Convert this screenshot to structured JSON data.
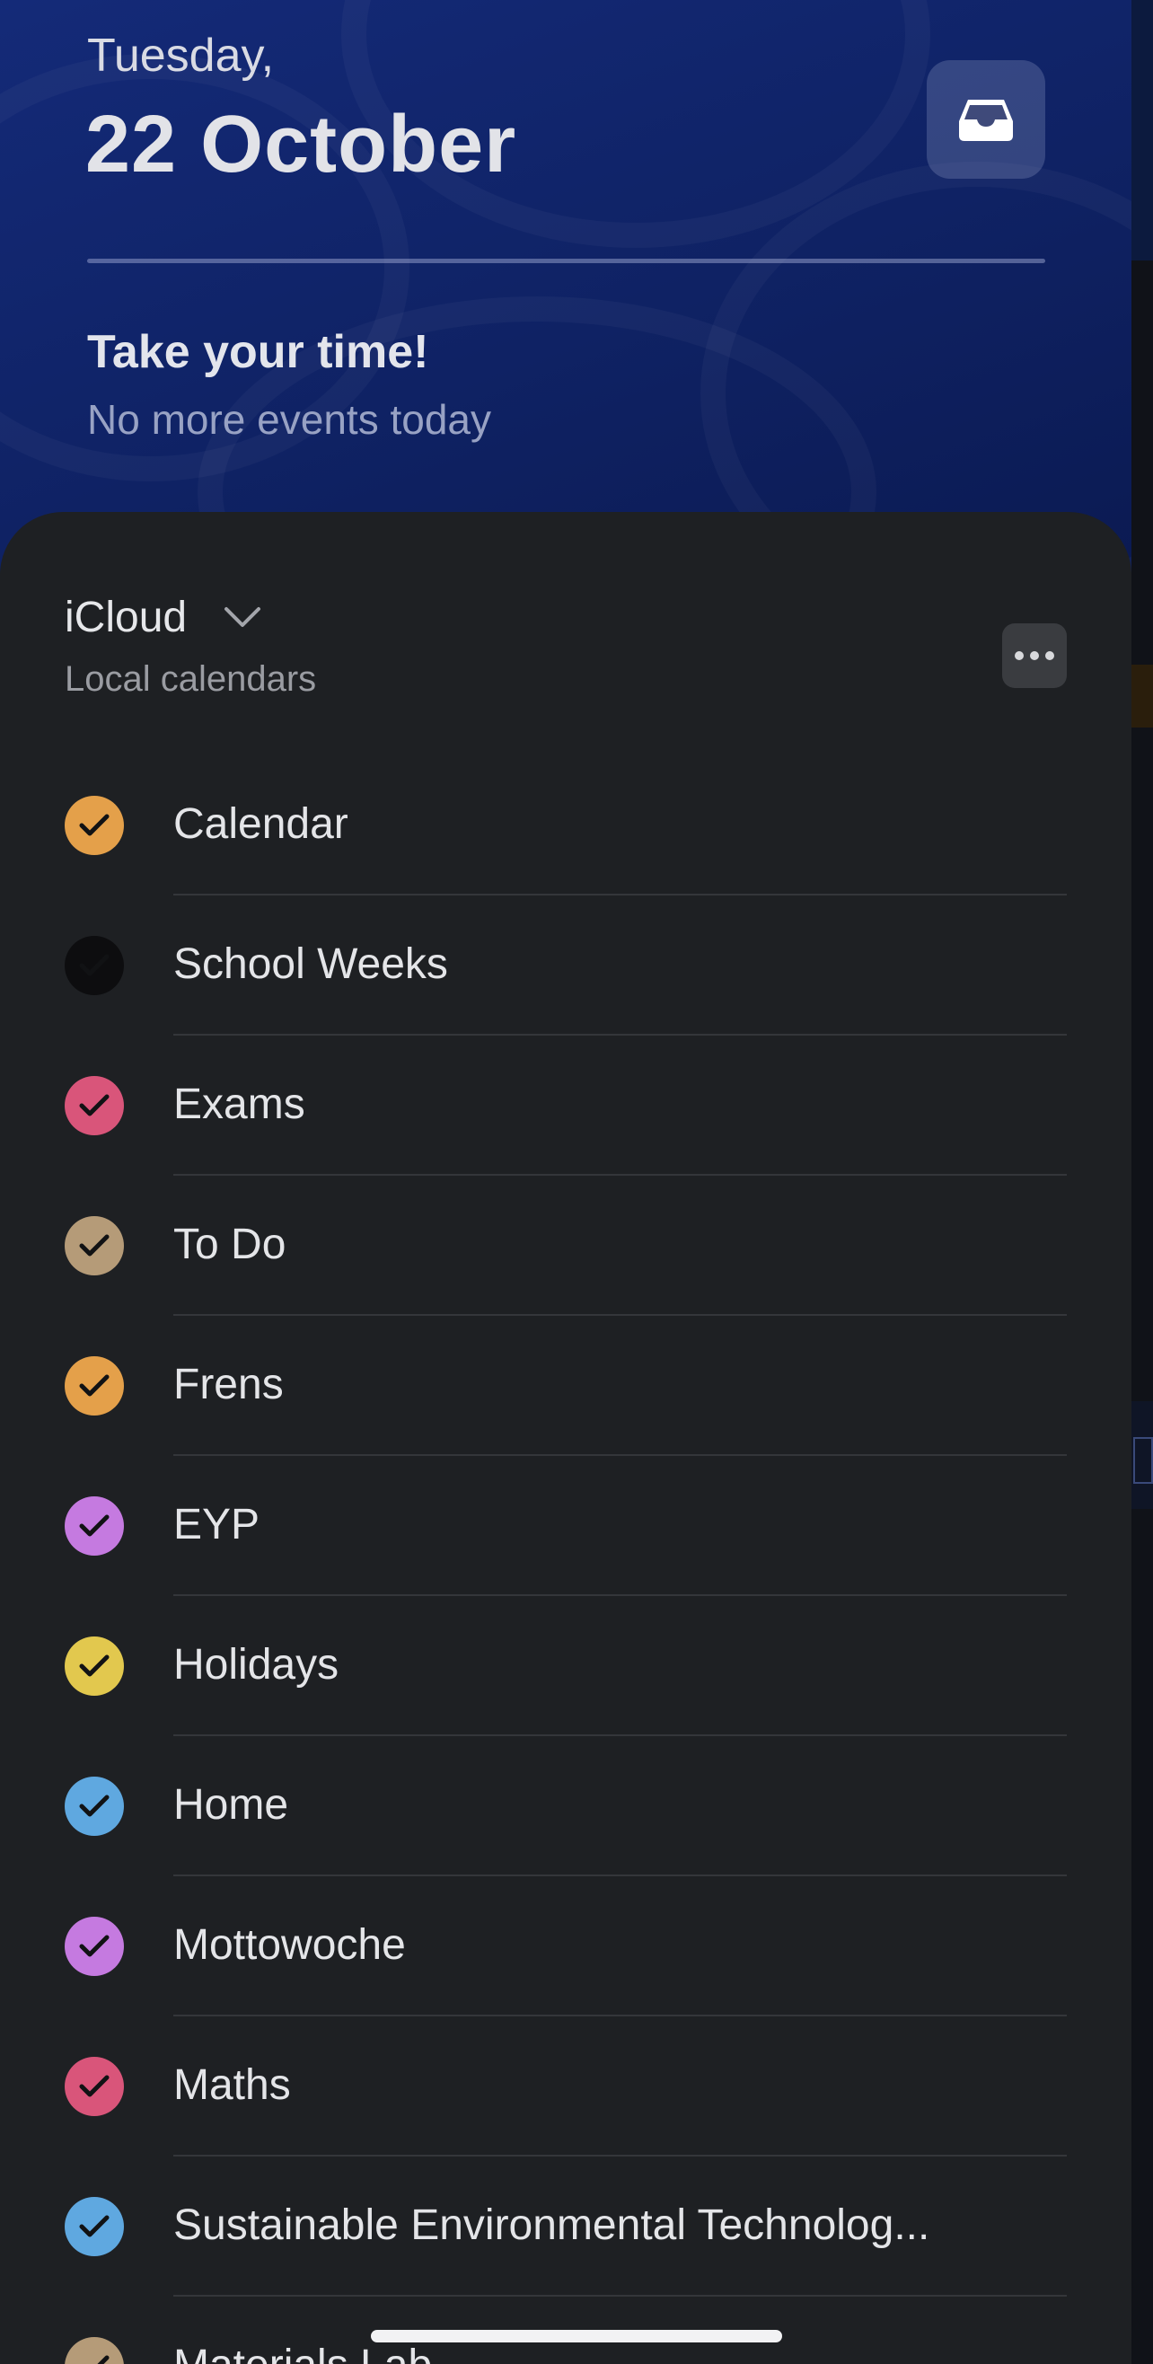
{
  "header": {
    "day": "Tuesday,",
    "date": "22 October",
    "headline": "Take your time!",
    "subline": "No more events today",
    "inbox_icon": "inbox-tray-icon"
  },
  "source": {
    "name": "iCloud",
    "subtitle": "Local calendars",
    "chevron_icon": "chevron-down-icon",
    "more_icon": "ellipsis-icon"
  },
  "calendars": [
    {
      "label": "Calendar",
      "color": "#e4a04a",
      "checked": true
    },
    {
      "label": "School Weeks",
      "color": "#0d0d0f",
      "checked": true
    },
    {
      "label": "Exams",
      "color": "#d9557a",
      "checked": true
    },
    {
      "label": "To Do",
      "color": "#b59b78",
      "checked": true
    },
    {
      "label": "Frens",
      "color": "#e4a04a",
      "checked": true
    },
    {
      "label": "EYP",
      "color": "#c57ae0",
      "checked": true
    },
    {
      "label": "Holidays",
      "color": "#e2c84e",
      "checked": true
    },
    {
      "label": "Home",
      "color": "#5fa8e0",
      "checked": true
    },
    {
      "label": "Mottowoche",
      "color": "#c57ae0",
      "checked": true
    },
    {
      "label": "Maths",
      "color": "#d9557a",
      "checked": true
    },
    {
      "label": "Sustainable Environmental Technolog...",
      "color": "#5fa8e0",
      "checked": true
    },
    {
      "label": "Materials Lab",
      "color": "#b59b78",
      "checked": true
    }
  ],
  "colors": {
    "header_bg": "#132a74",
    "sheet_bg": "#1e2023",
    "check_mark": "#111214"
  }
}
